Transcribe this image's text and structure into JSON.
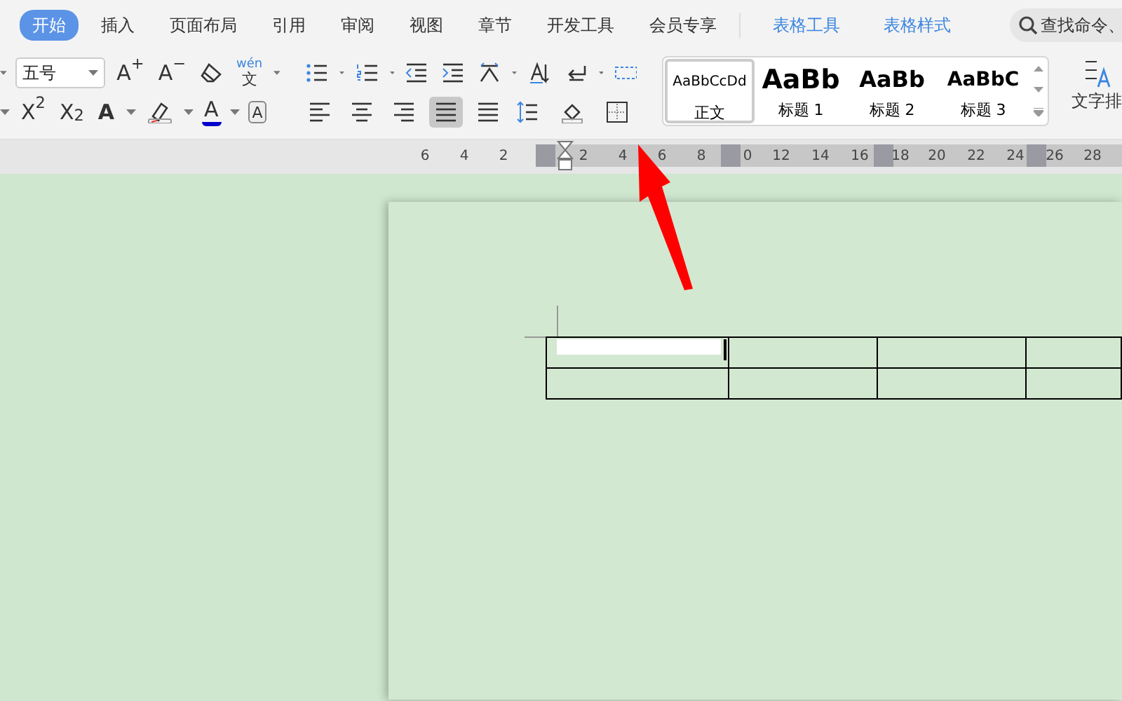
{
  "tabs": [
    {
      "label": "开始",
      "selected": true,
      "kind": "main"
    },
    {
      "label": "插入",
      "selected": false,
      "kind": "main"
    },
    {
      "label": "页面布局",
      "selected": false,
      "kind": "main"
    },
    {
      "label": "引用",
      "selected": false,
      "kind": "main"
    },
    {
      "label": "审阅",
      "selected": false,
      "kind": "main"
    },
    {
      "label": "视图",
      "selected": false,
      "kind": "main"
    },
    {
      "label": "章节",
      "selected": false,
      "kind": "main"
    },
    {
      "label": "开发工具",
      "selected": false,
      "kind": "main"
    },
    {
      "label": "会员专享",
      "selected": false,
      "kind": "main"
    },
    {
      "label": "表格工具",
      "selected": false,
      "kind": "context"
    },
    {
      "label": "表格样式",
      "selected": false,
      "kind": "context"
    }
  ],
  "search": {
    "placeholder": "查找命令、"
  },
  "font": {
    "size": "五号",
    "row1": [
      {
        "kind": "grow",
        "glyph": "A$^{+}$"
      },
      {
        "kind": "shrink",
        "glyph": "A$^{−}$"
      },
      {
        "kind": "clear"
      },
      {
        "kind": "phonetic",
        "glyph": "wén",
        "base": "文"
      }
    ],
    "row2": [
      {
        "kind": "superscript",
        "glyph": "X$^{2}$"
      },
      {
        "kind": "subscript",
        "glyph": "X$_{2}$"
      },
      {
        "kind": "effect",
        "glyph": "A"
      },
      {
        "kind": "highlight"
      },
      {
        "kind": "color",
        "glyph": "A"
      },
      {
        "kind": "border",
        "glyph": "A"
      }
    ]
  },
  "paragraph": {
    "align": [
      {
        "selected": false
      },
      {
        "selected": false
      },
      {
        "selected": false
      },
      {
        "selected": true
      },
      {
        "selected": false
      }
    ]
  },
  "styles": [
    {
      "preview": "AaBbCcDd",
      "label": "正文",
      "selected": true,
      "kind": "body"
    },
    {
      "preview": "AaBb",
      "label": "标题 1",
      "selected": false,
      "kind": "h1"
    },
    {
      "preview": "AaBb",
      "label": "标题 2",
      "selected": false,
      "kind": "h2"
    },
    {
      "preview": "AaBbC",
      "label": "标题 3",
      "selected": false,
      "kind": "h3"
    }
  ],
  "text_layout": {
    "label": "文字排"
  },
  "ruler": [
    {
      "kind": "label",
      "text": "6"
    },
    {
      "kind": "label",
      "text": "4"
    },
    {
      "kind": "label",
      "text": "2"
    },
    {
      "kind": "marker"
    },
    {
      "kind": "label",
      "text": "2"
    },
    {
      "kind": "label",
      "text": "4"
    },
    {
      "kind": "label",
      "text": "6"
    },
    {
      "kind": "label",
      "text": "8"
    },
    {
      "kind": "marker"
    },
    {
      "kind": "label",
      "text": "0"
    },
    {
      "kind": "label",
      "text": "12"
    },
    {
      "kind": "label",
      "text": "14"
    },
    {
      "kind": "label",
      "text": "16"
    },
    {
      "kind": "marker"
    },
    {
      "kind": "label",
      "text": "18"
    },
    {
      "kind": "label",
      "text": "20"
    },
    {
      "kind": "label",
      "text": "22"
    },
    {
      "kind": "label",
      "text": "24"
    },
    {
      "kind": "marker"
    },
    {
      "kind": "label",
      "text": "26"
    },
    {
      "kind": "label",
      "text": "28"
    }
  ],
  "table": {
    "rows": [
      {
        "cells": [
          {
            "selected": true
          },
          {
            "selected": false
          },
          {
            "selected": false
          },
          {
            "selected": false
          }
        ]
      },
      {
        "cells": [
          {
            "selected": false
          },
          {
            "selected": false
          },
          {
            "selected": false
          },
          {
            "selected": false
          }
        ]
      }
    ]
  }
}
